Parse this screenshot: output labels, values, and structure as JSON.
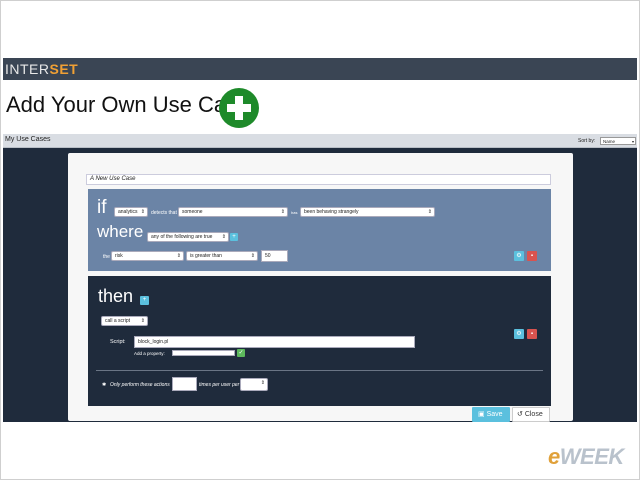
{
  "brand": {
    "name_prefix": "INTER",
    "name_suffix": "SET"
  },
  "heading": {
    "title": "Add Your Own Use Case!",
    "add_icon": "plus-circle-icon"
  },
  "app": {
    "title": "My Use Cases",
    "sort_label": "Sort by:",
    "sort_value": "Name"
  },
  "use_case": {
    "name": "A New Use Case",
    "if_block": {
      "keyword": "if",
      "source_select": "analytics",
      "detects_text": "detects that",
      "subject_select": "someone",
      "has_text": "has",
      "behavior_select": "been behaving strangely",
      "where_keyword": "where",
      "condition_select": "any of the following are true",
      "the_text": "the",
      "field_select": "risk",
      "operator_select": "is greater than",
      "value": "50"
    },
    "then_block": {
      "keyword": "then",
      "action_select": "call a script",
      "script_label": "Script:",
      "script_value": "block_login.pl",
      "add_property_label": "Add a property:",
      "limit_text_before": "Only perform these actions",
      "limit_text_after": "times per user per"
    },
    "buttons": {
      "save": "Save",
      "close": "Close"
    }
  },
  "watermark": {
    "prefix": "e",
    "suffix": "WEEK"
  },
  "colors": {
    "if_block_bg": "#6b84a6",
    "then_block_bg": "#1f2b3c",
    "save_button": "#5bc0de",
    "delete_button": "#d9534f",
    "add_icon_green": "#1e8a2a",
    "brand_accent": "#f0a034"
  }
}
